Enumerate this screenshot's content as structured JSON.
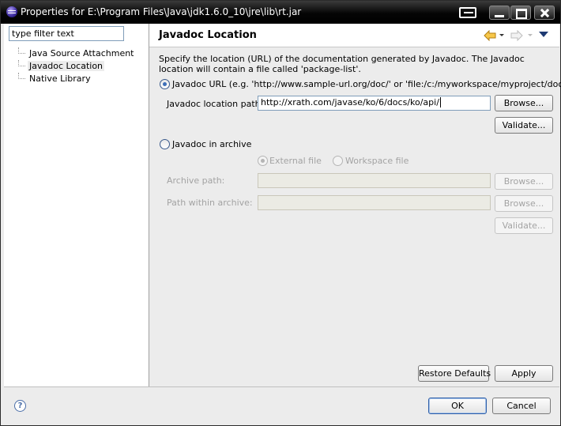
{
  "window": {
    "title": "Properties for E:\\Program Files\\Java\\jdk1.6.0_10\\jre\\lib\\rt.jar"
  },
  "sidebar": {
    "filter_placeholder": "type filter text",
    "filter_value": "type filter text",
    "items": [
      {
        "label": "Java Source Attachment",
        "selected": false
      },
      {
        "label": "Javadoc Location",
        "selected": true
      },
      {
        "label": "Native Library",
        "selected": false
      }
    ]
  },
  "page": {
    "title": "Javadoc Location",
    "description": "Specify the location (URL) of the documentation generated by Javadoc. The Javadoc location will contain a file called 'package-list'.",
    "url_option": {
      "label": "Javadoc URL (e.g. 'http://www.sample-url.org/doc/' or 'file:/c:/myworkspace/myproject/doc')",
      "selected": true,
      "path_label": "Javadoc location path:",
      "path_value": "http://xrath.com/javase/ko/6/docs/ko/api/",
      "browse_label": "Browse...",
      "validate_label": "Validate..."
    },
    "archive_option": {
      "label": "Javadoc in archive",
      "selected": false,
      "external_label": "External file",
      "workspace_label": "Workspace file",
      "archive_path_label": "Archive path:",
      "archive_path_value": "",
      "path_within_label": "Path within archive:",
      "path_within_value": "",
      "browse_label": "Browse...",
      "validate_label": "Validate..."
    },
    "restore_defaults_label": "Restore Defaults",
    "apply_label": "Apply"
  },
  "footer": {
    "help_glyph": "?",
    "ok_label": "OK",
    "cancel_label": "Cancel"
  },
  "colors": {
    "accent": "#3d6fb8",
    "title_bar": "#000000",
    "disabled_text": "#a3a3a3"
  },
  "icons": [
    "app-icon",
    "restore-icon",
    "minimize-icon",
    "maximize-icon",
    "close-icon",
    "back-arrow-icon",
    "forward-arrow-icon",
    "view-menu-icon",
    "help-icon"
  ]
}
